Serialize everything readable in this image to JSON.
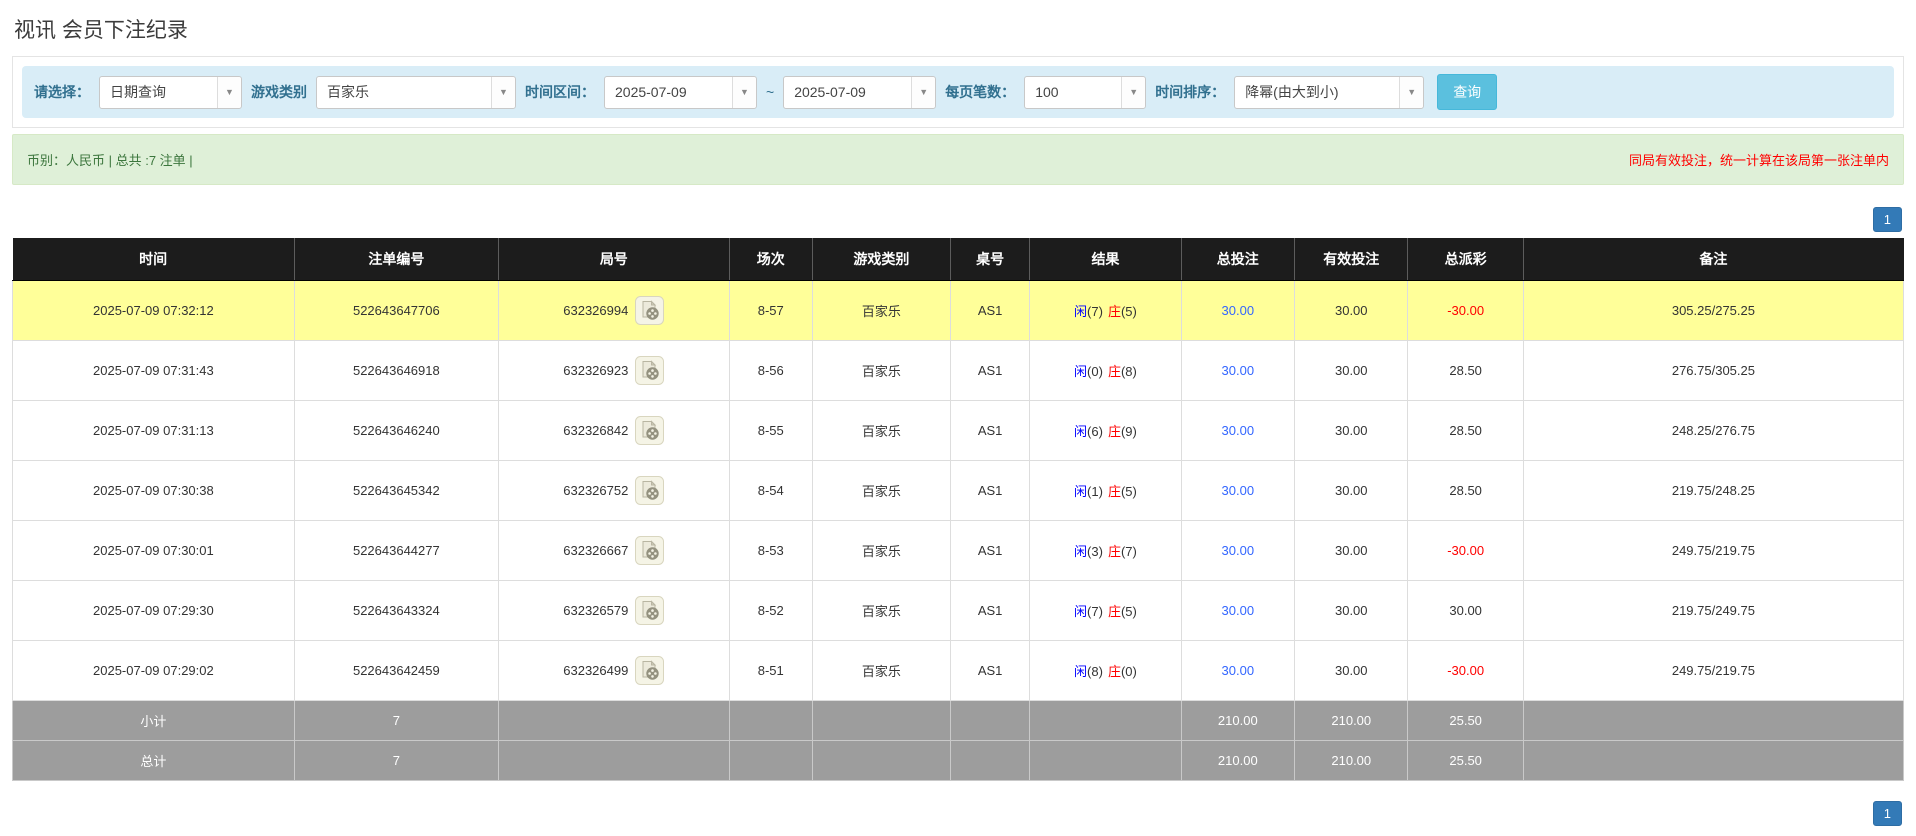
{
  "page": {
    "title": "视讯 会员下注纪录"
  },
  "filters": {
    "select_label": "请选择：",
    "select_value": "日期查询",
    "game_type_label": "游戏类别",
    "game_type_value": "百家乐",
    "time_range_label": "时间区间：",
    "date_from": "2025-07-09",
    "tilde": "~",
    "date_to": "2025-07-09",
    "page_size_label": "每页笔数：",
    "page_size_value": "100",
    "sort_label": "时间排序：",
    "sort_value": "降幂(由大到小)",
    "search_button": "查询"
  },
  "summary": {
    "left_text": "币别：人民币 | 总共 :7 注单 |",
    "right_note": "同局有效投注，统一计算在该局第一张注单内"
  },
  "pagination": {
    "page": "1"
  },
  "colors": {
    "header_bg": "#1c1c1c",
    "highlight_row": "#ffff99",
    "bet_link_blue": "#3366ff",
    "player_blue": "#0000ff",
    "banker_red": "#ff0000",
    "negative_red": "#ff0000",
    "summary_row_bg": "#9d9d9d",
    "search_button_bg": "#5bc0de",
    "pagination_bg": "#337ab7",
    "filter_bar_bg": "#d9edf7",
    "summary_bar_bg": "#dff0d8"
  },
  "table": {
    "headers": [
      "时间",
      "注单编号",
      "局号",
      "场次",
      "游戏类别",
      "桌号",
      "结果",
      "总投注",
      "有效投注",
      "总派彩",
      "备注"
    ],
    "col_widths": [
      "14.9%",
      "10.8%",
      "12.2%",
      "4.4%",
      "7.3%",
      "4.2%",
      "8.0%",
      "6.0%",
      "6.0%",
      "6.1%",
      "20.1%"
    ],
    "rows": [
      {
        "highlighted": true,
        "time": "2025-07-09 07:32:12",
        "bet_id": "522643647706",
        "round_id": "632326994",
        "session": "8-57",
        "game": "百家乐",
        "table_no": "AS1",
        "result": {
          "player_char": "闲",
          "player_num": "(7)",
          "banker_char": "庄",
          "banker_num": "(5)"
        },
        "total_bet": "30.00",
        "valid_bet": "30.00",
        "payout": "-30.00",
        "remark": "305.25/275.25"
      },
      {
        "highlighted": false,
        "time": "2025-07-09 07:31:43",
        "bet_id": "522643646918",
        "round_id": "632326923",
        "session": "8-56",
        "game": "百家乐",
        "table_no": "AS1",
        "result": {
          "player_char": "闲",
          "player_num": "(0)",
          "banker_char": "庄",
          "banker_num": "(8)"
        },
        "total_bet": "30.00",
        "valid_bet": "30.00",
        "payout": "28.50",
        "remark": "276.75/305.25"
      },
      {
        "highlighted": false,
        "time": "2025-07-09 07:31:13",
        "bet_id": "522643646240",
        "round_id": "632326842",
        "session": "8-55",
        "game": "百家乐",
        "table_no": "AS1",
        "result": {
          "player_char": "闲",
          "player_num": "(6)",
          "banker_char": "庄",
          "banker_num": "(9)"
        },
        "total_bet": "30.00",
        "valid_bet": "30.00",
        "payout": "28.50",
        "remark": "248.25/276.75"
      },
      {
        "highlighted": false,
        "time": "2025-07-09 07:30:38",
        "bet_id": "522643645342",
        "round_id": "632326752",
        "session": "8-54",
        "game": "百家乐",
        "table_no": "AS1",
        "result": {
          "player_char": "闲",
          "player_num": "(1)",
          "banker_char": "庄",
          "banker_num": "(5)"
        },
        "total_bet": "30.00",
        "valid_bet": "30.00",
        "payout": "28.50",
        "remark": "219.75/248.25"
      },
      {
        "highlighted": false,
        "time": "2025-07-09 07:30:01",
        "bet_id": "522643644277",
        "round_id": "632326667",
        "session": "8-53",
        "game": "百家乐",
        "table_no": "AS1",
        "result": {
          "player_char": "闲",
          "player_num": "(3)",
          "banker_char": "庄",
          "banker_num": "(7)"
        },
        "total_bet": "30.00",
        "valid_bet": "30.00",
        "payout": "-30.00",
        "remark": "249.75/219.75"
      },
      {
        "highlighted": false,
        "time": "2025-07-09 07:29:30",
        "bet_id": "522643643324",
        "round_id": "632326579",
        "session": "8-52",
        "game": "百家乐",
        "table_no": "AS1",
        "result": {
          "player_char": "闲",
          "player_num": "(7)",
          "banker_char": "庄",
          "banker_num": "(5)"
        },
        "total_bet": "30.00",
        "valid_bet": "30.00",
        "payout": "30.00",
        "remark": "219.75/249.75"
      },
      {
        "highlighted": false,
        "time": "2025-07-09 07:29:02",
        "bet_id": "522643642459",
        "round_id": "632326499",
        "session": "8-51",
        "game": "百家乐",
        "table_no": "AS1",
        "result": {
          "player_char": "闲",
          "player_num": "(8)",
          "banker_char": "庄",
          "banker_num": "(0)"
        },
        "total_bet": "30.00",
        "valid_bet": "30.00",
        "payout": "-30.00",
        "remark": "249.75/219.75"
      }
    ],
    "subtotal": {
      "label": "小计",
      "count": "7",
      "total_bet": "210.00",
      "valid_bet": "210.00",
      "payout": "25.50"
    },
    "total": {
      "label": "总计",
      "count": "7",
      "total_bet": "210.00",
      "valid_bet": "210.00",
      "payout": "25.50"
    }
  }
}
